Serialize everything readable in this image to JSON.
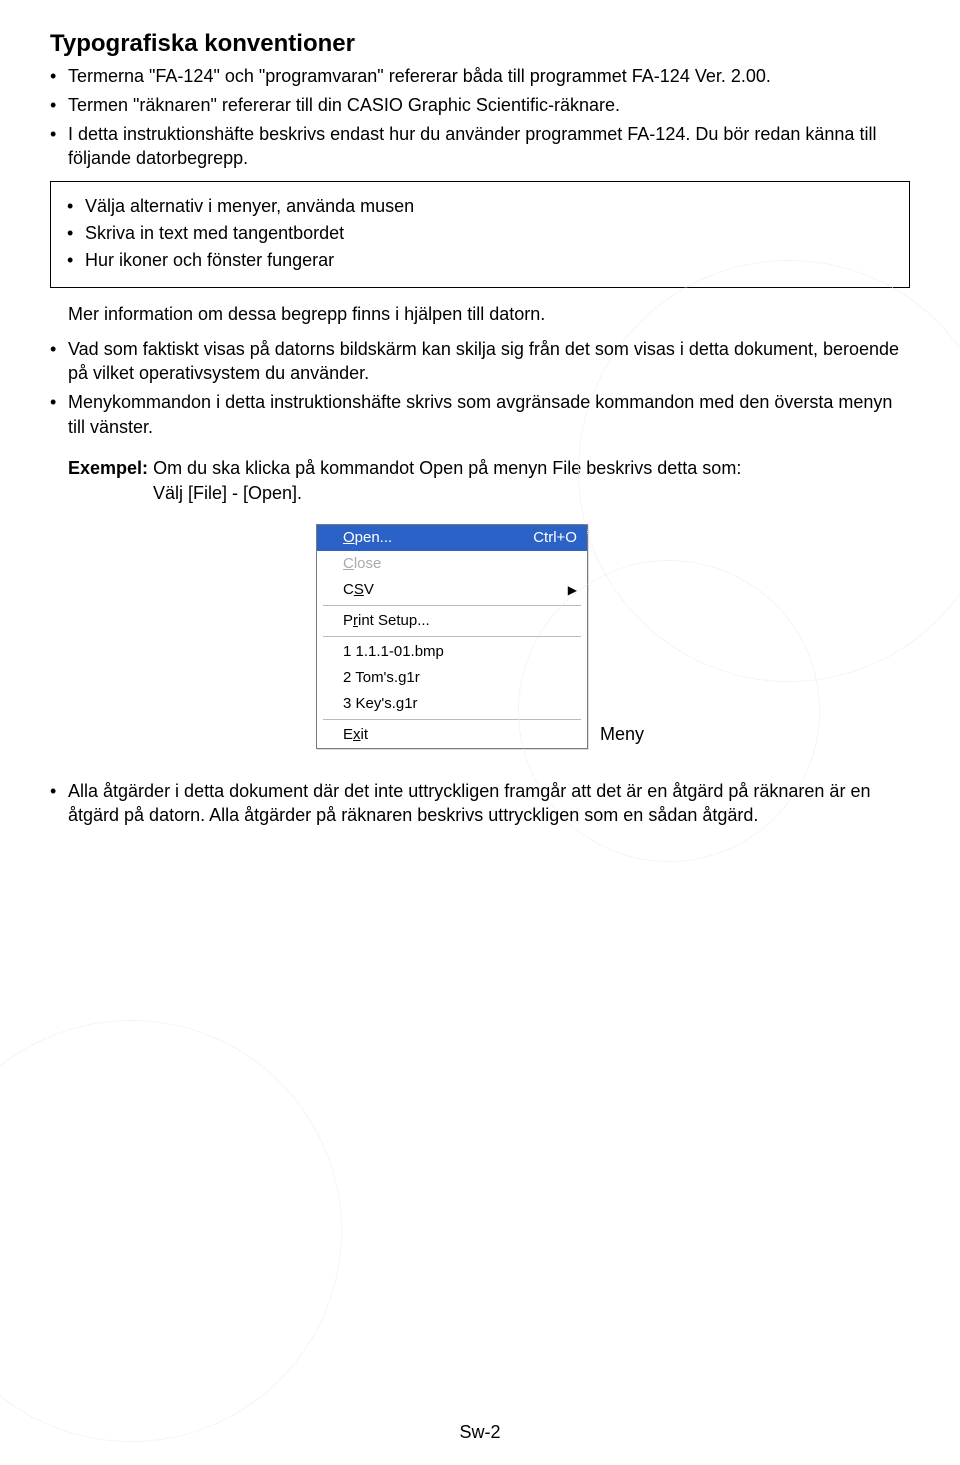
{
  "title": "Typografiska konventioner",
  "bul1": "Termerna \"FA-124\" och \"programvaran\" refererar båda till programmet FA-124 Ver. 2.00.",
  "bul2": "Termen \"räknaren\" refererar till din CASIO Graphic Scientific-räknare.",
  "bul3": "I detta instruktionshäfte beskrivs endast hur du använder programmet FA-124. Du bör redan känna till följande datorbegrepp.",
  "boxb1": "Välja alternativ i menyer, använda musen",
  "boxb2": "Skriva in text med tangentbordet",
  "boxb3": "Hur ikoner och fönster fungerar",
  "afterbox": "Mer information om dessa begrepp finns i hjälpen till datorn.",
  "bul4": "Vad som faktiskt visas på datorns bildskärm kan skilja sig från det som visas i detta dokument, beroende på vilket operativsystem du använder.",
  "bul5": "Menykommandon i detta instruktionshäfte skrivs som avgränsade kommandon med den översta menyn till vänster.",
  "ex_label": "Exempel:",
  "ex_text1": "Om du ska klicka på kommandot Open på menyn File beskrivs detta som:",
  "ex_text2": "Välj [File] - [Open].",
  "menu": {
    "open": "Open...",
    "open_sc": "Ctrl+O",
    "close": "Close",
    "csv": "CSV",
    "print": "Print Setup...",
    "r1": "1 1.1.1-01.bmp",
    "r2": "2 Tom's.g1r",
    "r3": "3 Key's.g1r",
    "exit": "Exit"
  },
  "menulabel": "Meny",
  "bul6": "Alla åtgärder i detta dokument där det inte uttryckligen framgår att det är en åtgärd på räknaren är en åtgärd på datorn. Alla åtgärder på räknaren beskrivs uttryckligen som en sådan åtgärd.",
  "pageno": "Sw-2"
}
